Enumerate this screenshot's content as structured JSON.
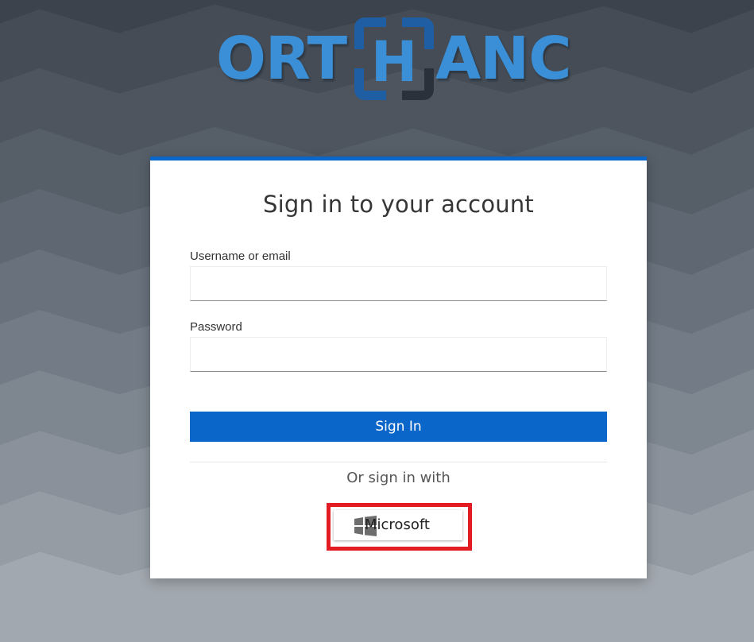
{
  "logo": {
    "text_left": "ORT",
    "text_mid": "H",
    "text_right": "ANC"
  },
  "login": {
    "title": "Sign in to your account",
    "username_label": "Username or email",
    "username_value": "",
    "password_label": "Password",
    "password_value": "",
    "submit_label": "Sign In",
    "divider_text": "Or sign in with",
    "providers": [
      {
        "label": "Microsoft",
        "icon": "windows-icon"
      }
    ]
  },
  "colors": {
    "accent": "#0b66c9",
    "logo_blue": "#3a8fd6",
    "highlight": "#e31c24"
  }
}
